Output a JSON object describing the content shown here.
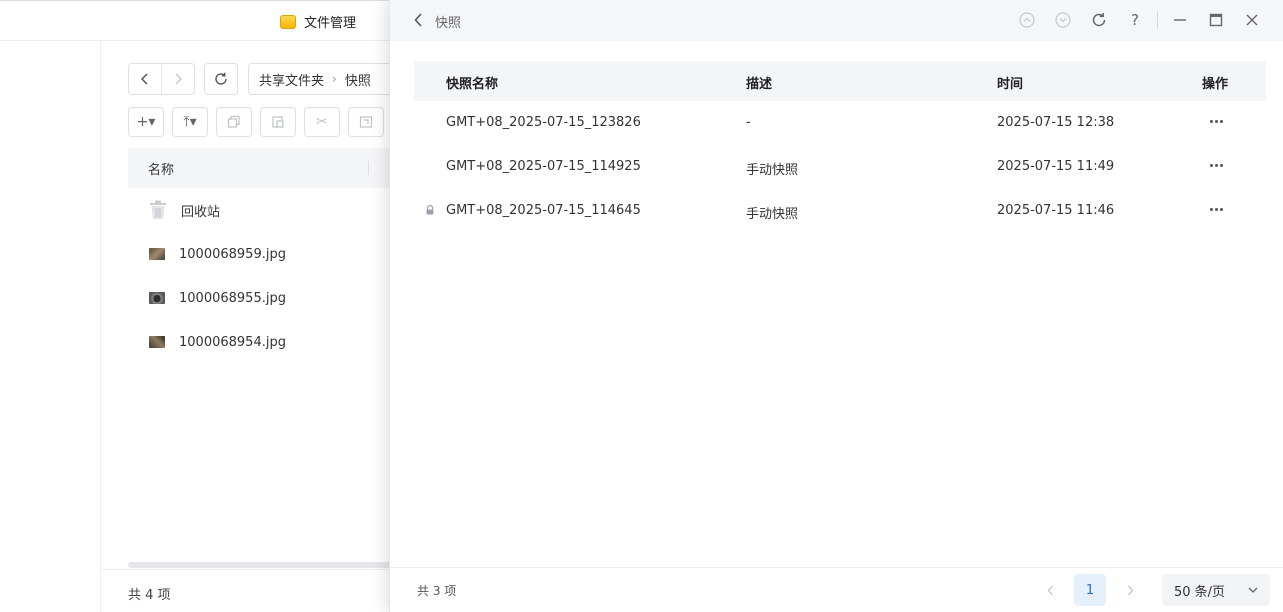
{
  "file_manager": {
    "title": "文件管理",
    "breadcrumb": [
      "共享文件夹",
      "快照"
    ],
    "list_header": {
      "name_label": "名称"
    },
    "files": [
      {
        "name": "回收站",
        "icon": "trash-icon"
      },
      {
        "name": "1000068959.jpg",
        "icon": "image-thumbnail"
      },
      {
        "name": "1000068955.jpg",
        "icon": "image-thumbnail"
      },
      {
        "name": "1000068954.jpg",
        "icon": "image-thumbnail"
      }
    ],
    "footer_count": "共 4 项"
  },
  "snapshot_panel": {
    "title": "快照",
    "columns": {
      "name": "快照名称",
      "desc": "描述",
      "time": "时间",
      "actions": "操作"
    },
    "rows": [
      {
        "name": "GMT+08_2025-07-15_123826",
        "desc": "-",
        "time": "2025-07-15 12:38",
        "locked": false
      },
      {
        "name": "GMT+08_2025-07-15_114925",
        "desc": "手动快照",
        "time": "2025-07-15 11:49",
        "locked": false
      },
      {
        "name": "GMT+08_2025-07-15_114645",
        "desc": "手动快照",
        "time": "2025-07-15 11:46",
        "locked": true
      }
    ],
    "footer_count": "共 3 项",
    "pagination": {
      "current_page": "1",
      "page_size": "50 条/页"
    },
    "window_controls": {
      "help_label": "?"
    }
  },
  "colors": {
    "accent": "#1f6fd1",
    "accent_bg": "#e6f0fc",
    "folder_icon": "#f5b300"
  }
}
